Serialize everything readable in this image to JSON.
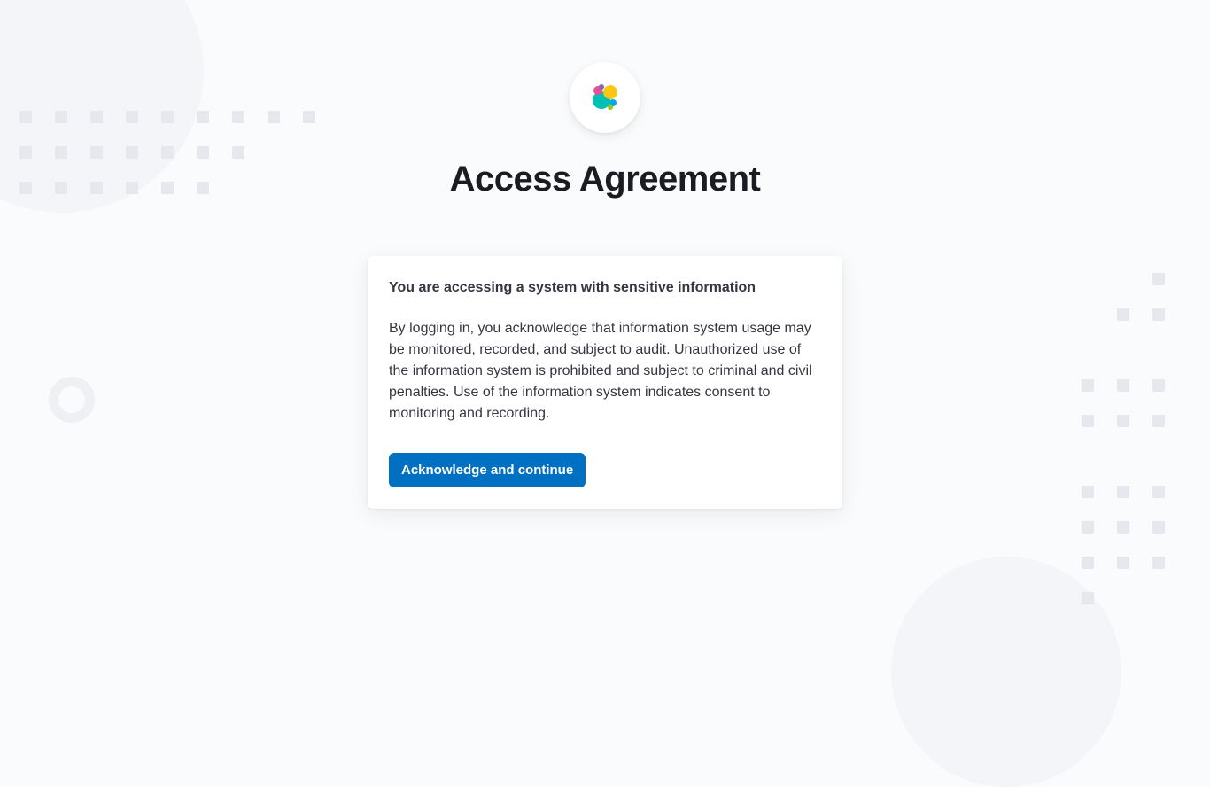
{
  "page": {
    "title": "Access Agreement"
  },
  "card": {
    "heading": "You are accessing a system with sensitive information",
    "body": "By logging in, you acknowledge that information system usage may be monitored, recorded, and subject to audit. Unauthorized use of the information system is prohibited and subject to criminal and civil penalties. Use of the information system indicates consent to monitoring and recording.",
    "button_label": "Acknowledge and continue"
  },
  "logo": {
    "name": "elastic-logo"
  },
  "colors": {
    "primary_button": "#0071c2",
    "text_heading": "#1a1c21",
    "text_body": "#343741",
    "page_bg": "#fafbfd",
    "card_bg": "#ffffff"
  }
}
